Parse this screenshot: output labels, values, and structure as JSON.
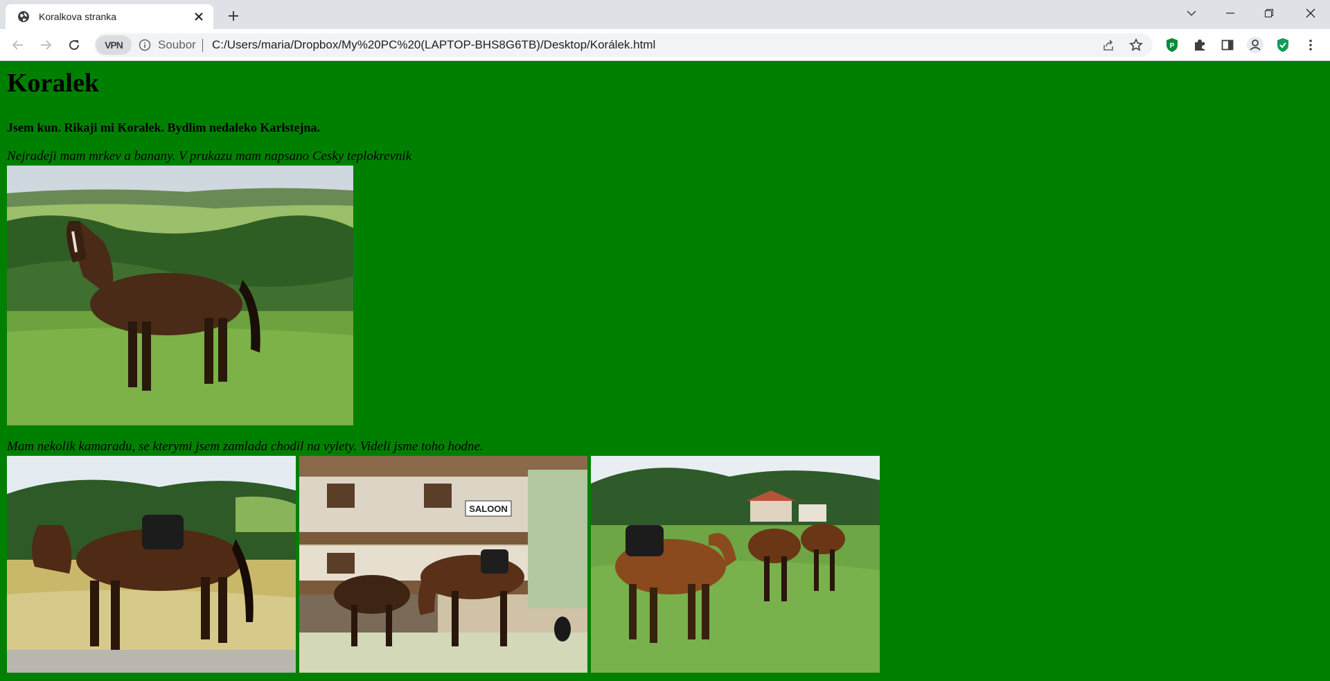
{
  "browser": {
    "tab_title": "Koralkova stranka",
    "vpn_label": "VPN",
    "scheme_label": "Soubor",
    "url": "C:/Users/maria/Dropbox/My%20PC%20(LAPTOP-BHS8G6TB)/Desktop/Korálek.html",
    "extension_p_label": "P"
  },
  "page": {
    "heading": "Koralek",
    "subheading": "Jsem kun. Rikaji mi Koralek. Bydlim nedaleko Karlstejna.",
    "intro": "Nejradeji mam mrkev a banany. V prukazu mam napsano Cesky teplokrevnik",
    "friends_text": "Mam nekolik kamaradu, se kterymi jsem zamlada chodil na vylety. Videli jsme toho hodne.",
    "saloon_sign": "SALOON",
    "background_color": "#008000"
  }
}
